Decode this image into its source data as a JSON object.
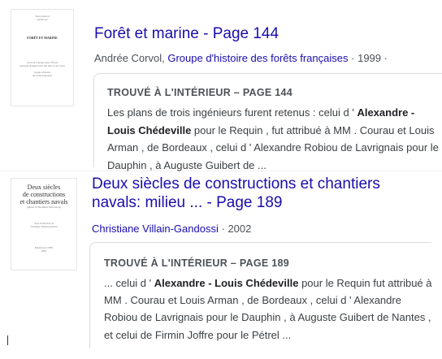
{
  "results": [
    {
      "title": "Forêt et marine - Page 144",
      "author": "Andrée Corvol",
      "publisher": "Groupe d'histoire des forêts françaises",
      "year": "1999",
      "sep": "·",
      "card_header": "TROUVÉ À L'INTÉRIEUR – PAGE 144",
      "snippet": [
        {
          "t": "Les plans de trois ingénieurs furent retenus : celui d ' "
        },
        {
          "t": "Alexandre - Louis Chédeville",
          "b": true
        },
        {
          "t": " pour le Requin , fut attribué à MM . Courau et Louis Arman , de Bordeaux , celui d ' Alexandre Robiou de Lavrignais pour le Dauphin , à Auguste Guibert de ..."
        }
      ],
      "thumbnail": {
        "top_lines": [
          "Texte réunis et",
          "publiés par"
        ],
        "title": "FORÊT ET MARINE",
        "middle_lines": [
          "Actes du colloque tenu à l'École",
          "nationale du génie rural, des eaux et des forêts"
        ],
        "bottom_lines": [
          "Groupe d'histoire",
          "des forêts françaises"
        ]
      }
    },
    {
      "title": "Deux siècles de constructions et chantiers navals: milieu ... - Page 189",
      "author": "Christiane Villain-Gandossi",
      "year": "2002",
      "sep": "·",
      "card_header": "TROUVÉ À L'INTÉRIEUR – PAGE 189",
      "snippet": [
        {
          "t": "... celui d ' "
        },
        {
          "t": "Alexandre - Louis Chédeville",
          "b": true
        },
        {
          "t": " pour le Requin fut attribué à MM . Courau et Louis Arman , de Bordeaux , celui d ' Alexandre Robiou de Lavrignais pour le Dauphin , à Auguste Guibert de Nantes , et celui de Firmin Joffre pour le Pétrel ..."
        }
      ],
      "thumbnail": {
        "title_lines": [
          "Deux siècles",
          "de constructions",
          "et chantiers navals"
        ],
        "subtitle": "(milieu XVIIe-milieu XIXe siècle)",
        "middle_lines": [
          "Sous la direction de",
          "Christiane Villain-Gandossi"
        ],
        "bottom_lines": [
          "Éditions du CTHS",
          "2002"
        ]
      }
    }
  ]
}
